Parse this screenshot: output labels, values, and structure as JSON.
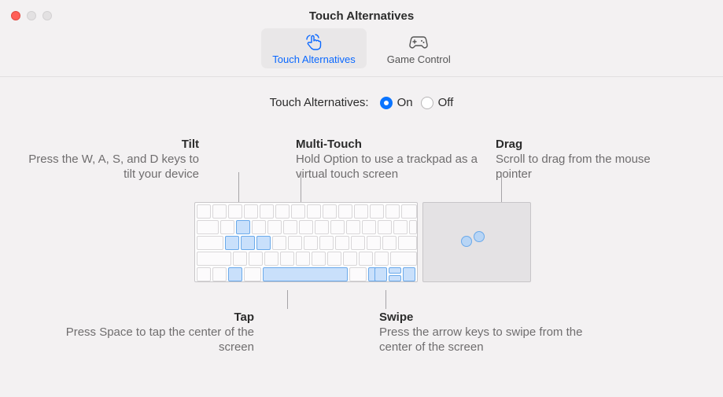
{
  "window": {
    "title": "Touch Alternatives"
  },
  "tabs": {
    "touch": "Touch Alternatives",
    "game": "Game Control"
  },
  "radio": {
    "label": "Touch Alternatives:",
    "on": "On",
    "off": "Off"
  },
  "desc": {
    "tilt": {
      "title": "Tilt",
      "body": "Press the W, A, S, and D keys to tilt your device"
    },
    "multi": {
      "title": "Multi-Touch",
      "body": "Hold Option to use a trackpad as a virtual touch screen"
    },
    "drag": {
      "title": "Drag",
      "body": "Scroll to drag from the mouse pointer"
    },
    "tap": {
      "title": "Tap",
      "body": "Press Space to tap the center of the screen"
    },
    "swipe": {
      "title": "Swipe",
      "body": "Press the arrow keys to swipe from the center of the screen"
    }
  }
}
